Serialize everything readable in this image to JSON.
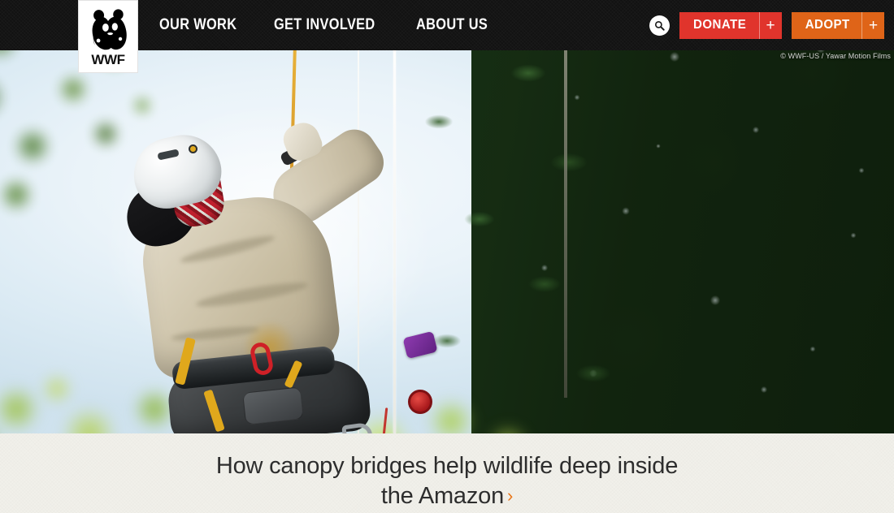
{
  "site": {
    "brand_name": "WWF",
    "logo_icon": "wwf-panda-logo"
  },
  "nav": {
    "links": [
      {
        "label": "OUR WORK"
      },
      {
        "label": "GET INVOLVED"
      },
      {
        "label": "ABOUT US"
      }
    ],
    "search": {
      "icon": "search-icon",
      "aria_label": "Search"
    },
    "actions": [
      {
        "id": "donate",
        "label": "DONATE",
        "expander": "+",
        "color": "#e0342c"
      },
      {
        "id": "adopt",
        "label": "ADOPT",
        "expander": "+",
        "color": "#df6418"
      }
    ]
  },
  "hero": {
    "alt": "Researcher in climbing harness and white helmet ascending a rope into the rainforest canopy",
    "credit": "© WWF-US / Yawar Motion Films"
  },
  "feature": {
    "headline": "How canopy bridges help wildlife deep inside the Amazon",
    "chevron": "›",
    "chevron_color": "#e8761a"
  }
}
